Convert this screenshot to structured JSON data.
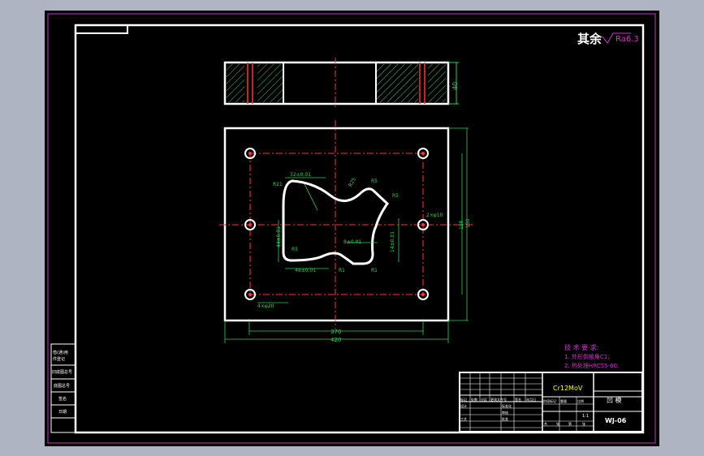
{
  "surface_roughness": {
    "prefix": "其余",
    "value": "Ra6.3"
  },
  "side_view": {
    "thickness": "40"
  },
  "plan_view": {
    "dims": {
      "top_width": "32±0.01",
      "left_height": "44±0.01",
      "bottom_width": "48±0.01",
      "right_small": "14±0.01",
      "mid": "8±0.01",
      "overall_width_inner": "370",
      "overall_width": "420",
      "overall_height_inner": "180",
      "overall_height": "150",
      "hole_dia": "4×φ20",
      "pin_dia": "2×φ10"
    },
    "radii": [
      "R21",
      "R5",
      "R5",
      "R1",
      "R1",
      "R25",
      "R5"
    ]
  },
  "technical_requirements": {
    "title": "技 术 要 求:",
    "items": [
      "1. 外形倒棱角C1;",
      "2. 热处理HRC55-60;"
    ]
  },
  "title_block": {
    "material": "Cr12MoV",
    "part_name": "凹 模",
    "drawing_no": "WJ-06",
    "scale": "1:1",
    "labels": [
      "标记",
      "处数",
      "分区",
      "更改文件号",
      "签名",
      "年月日",
      "设计",
      "标准化",
      "审核",
      "工艺",
      "批准",
      "阶段标记",
      "重量",
      "比例",
      "共",
      "张",
      "第",
      "张"
    ]
  },
  "left_stamp": [
    "借(通)用",
    "件登记",
    "旧底图总号",
    "底图总号",
    "签名",
    "日期"
  ],
  "colors": {
    "frame": "#ffffff",
    "border": "#cc33cc",
    "centerline": "#ff3333",
    "dimension": "#33cc55",
    "hatch": "#33cc99",
    "text": "#ffffff",
    "yellow": "#ffff00"
  }
}
